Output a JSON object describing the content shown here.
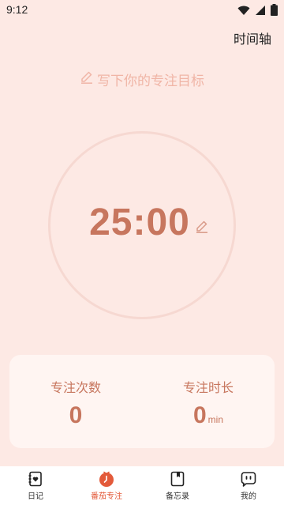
{
  "status_bar": {
    "time": "9:12"
  },
  "header": {
    "timeline_label": "时间轴"
  },
  "goal": {
    "placeholder": "写下你的专注目标"
  },
  "timer": {
    "value": "25:00"
  },
  "stats": {
    "count_label": "专注次数",
    "count_value": "0",
    "duration_label": "专注时长",
    "duration_value": "0",
    "duration_unit": "min"
  },
  "nav": {
    "items": [
      {
        "label": "日记",
        "icon": "diary-icon"
      },
      {
        "label": "番茄专注",
        "icon": "pomodoro-icon"
      },
      {
        "label": "备忘录",
        "icon": "memo-icon"
      },
      {
        "label": "我的",
        "icon": "profile-icon"
      }
    ],
    "active_index": 1
  },
  "colors": {
    "background": "#FDE9E4",
    "accent": "#C7765E",
    "active_tab": "#E35A3A",
    "goal_text": "#F0B5A6"
  }
}
